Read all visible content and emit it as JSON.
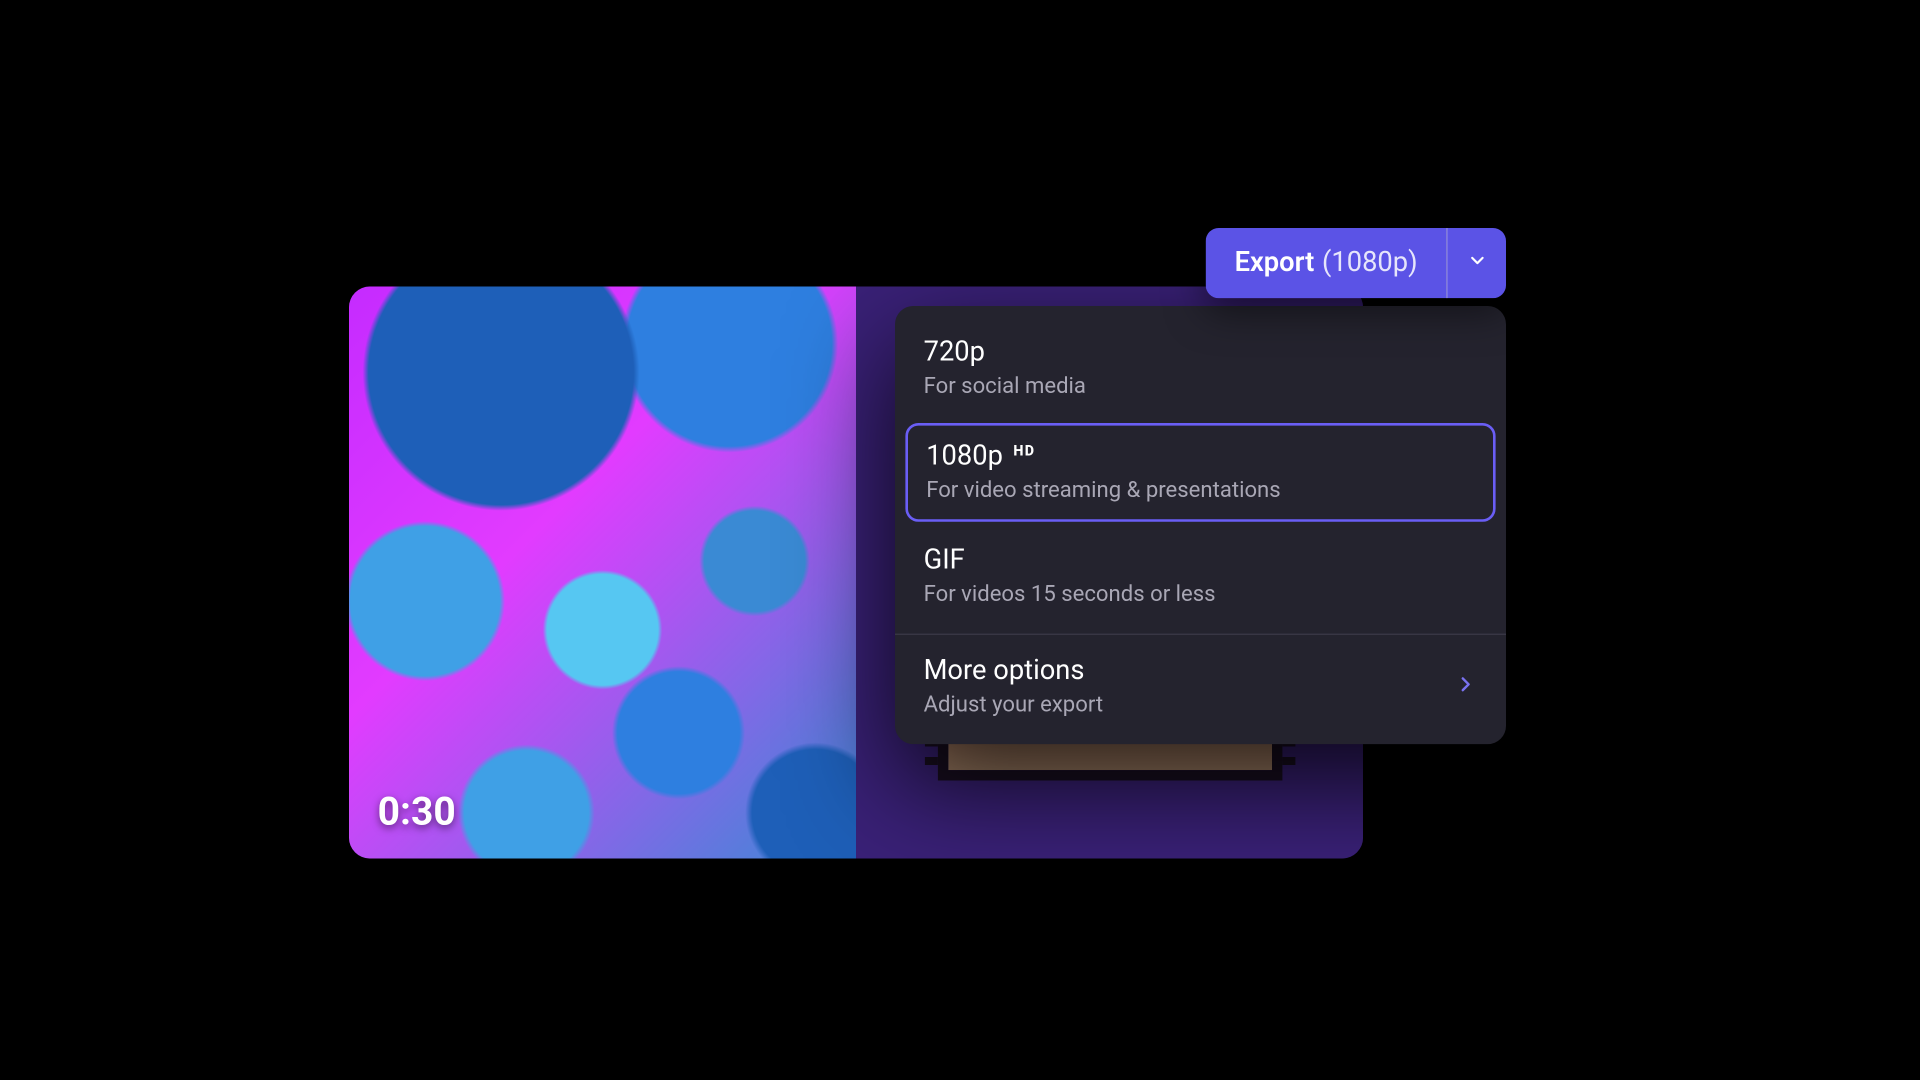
{
  "video": {
    "timestamp": "0:30"
  },
  "export_button": {
    "label": "Export",
    "resolution": "(1080p)"
  },
  "dropdown": {
    "options": [
      {
        "title": "720p",
        "subtitle": "For social media",
        "badge": "",
        "selected": false
      },
      {
        "title": "1080p",
        "subtitle": "For video streaming & presentations",
        "badge": "HD",
        "selected": true
      },
      {
        "title": "GIF",
        "subtitle": "For videos 15 seconds or less",
        "badge": "",
        "selected": false
      }
    ],
    "more": {
      "title": "More options",
      "subtitle": "Adjust your export"
    }
  }
}
